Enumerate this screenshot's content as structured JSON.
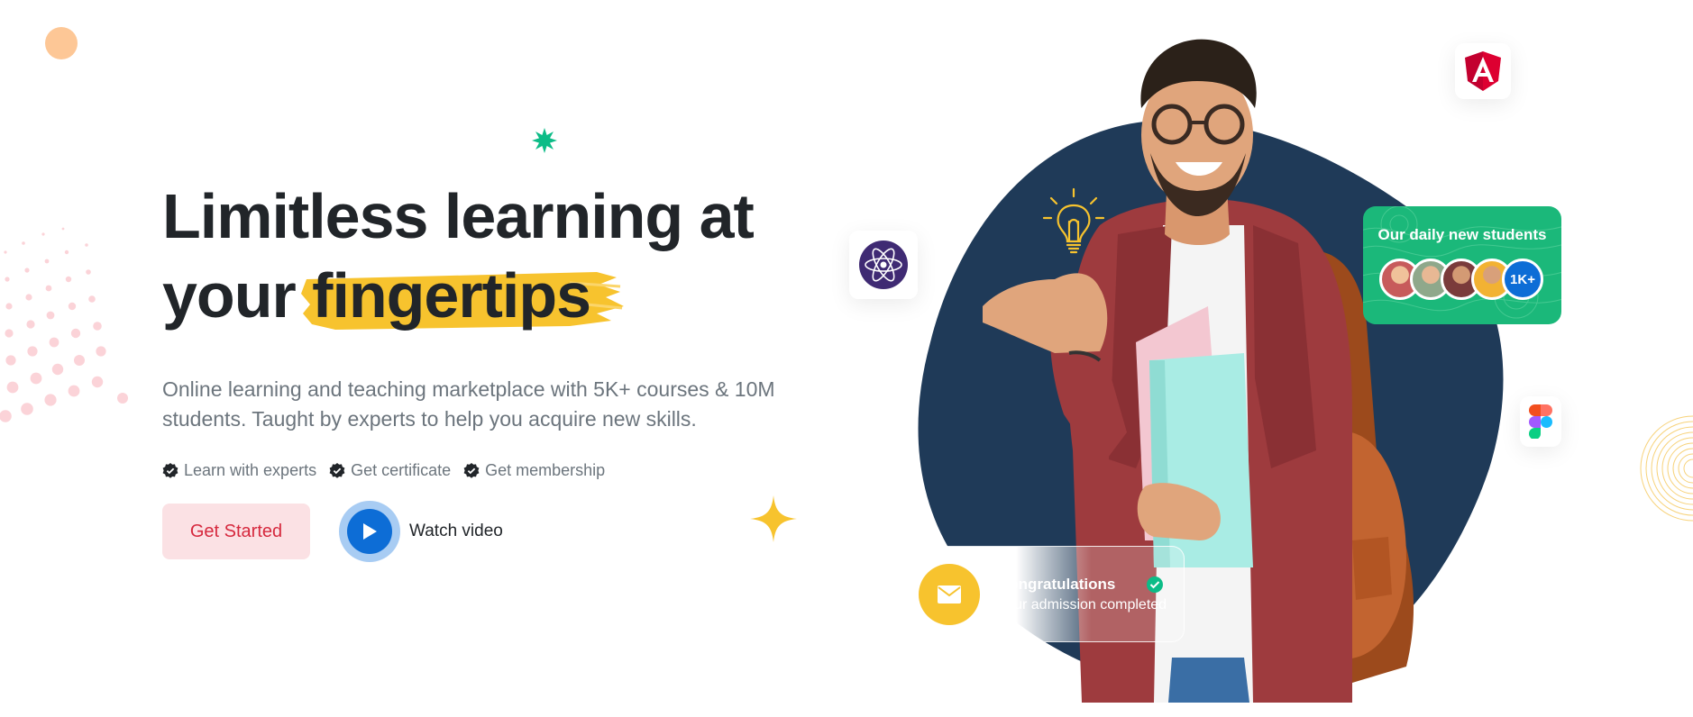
{
  "hero": {
    "title_line1": "Limitless learning at",
    "title_line2_prefix": "your",
    "title_highlight": "fingertips",
    "subtitle": "Online learning and teaching marketplace with 5K+ courses & 10M students. Taught by experts to help you acquire new skills.",
    "features": [
      "Learn with experts",
      "Get certificate",
      "Get membership"
    ],
    "cta_primary": "Get Started",
    "cta_video": "Watch video"
  },
  "students_card": {
    "title": "Our daily new students",
    "more_label": "1K+"
  },
  "congrats_card": {
    "title": "Congratulations",
    "subtitle": "Your admission completed"
  },
  "colors": {
    "primary_text": "#212529",
    "muted_text": "#6c757d",
    "danger": "#d6293e",
    "danger_soft": "#fbe1e4",
    "brand_blue": "#0d6dd6",
    "highlight_yellow": "#f7c32e",
    "success_green": "#1bb87a",
    "blob_navy": "#1f3a58"
  },
  "icons": [
    "orange-dot-decoration",
    "dot-pattern-decoration",
    "green-star-icon",
    "yellow-sparkle-icon",
    "rings-decoration",
    "check-badge-icon",
    "play-icon",
    "atom-icon",
    "angular-icon",
    "figma-icon",
    "lightbulb-icon",
    "mail-icon",
    "check-circle-icon"
  ]
}
